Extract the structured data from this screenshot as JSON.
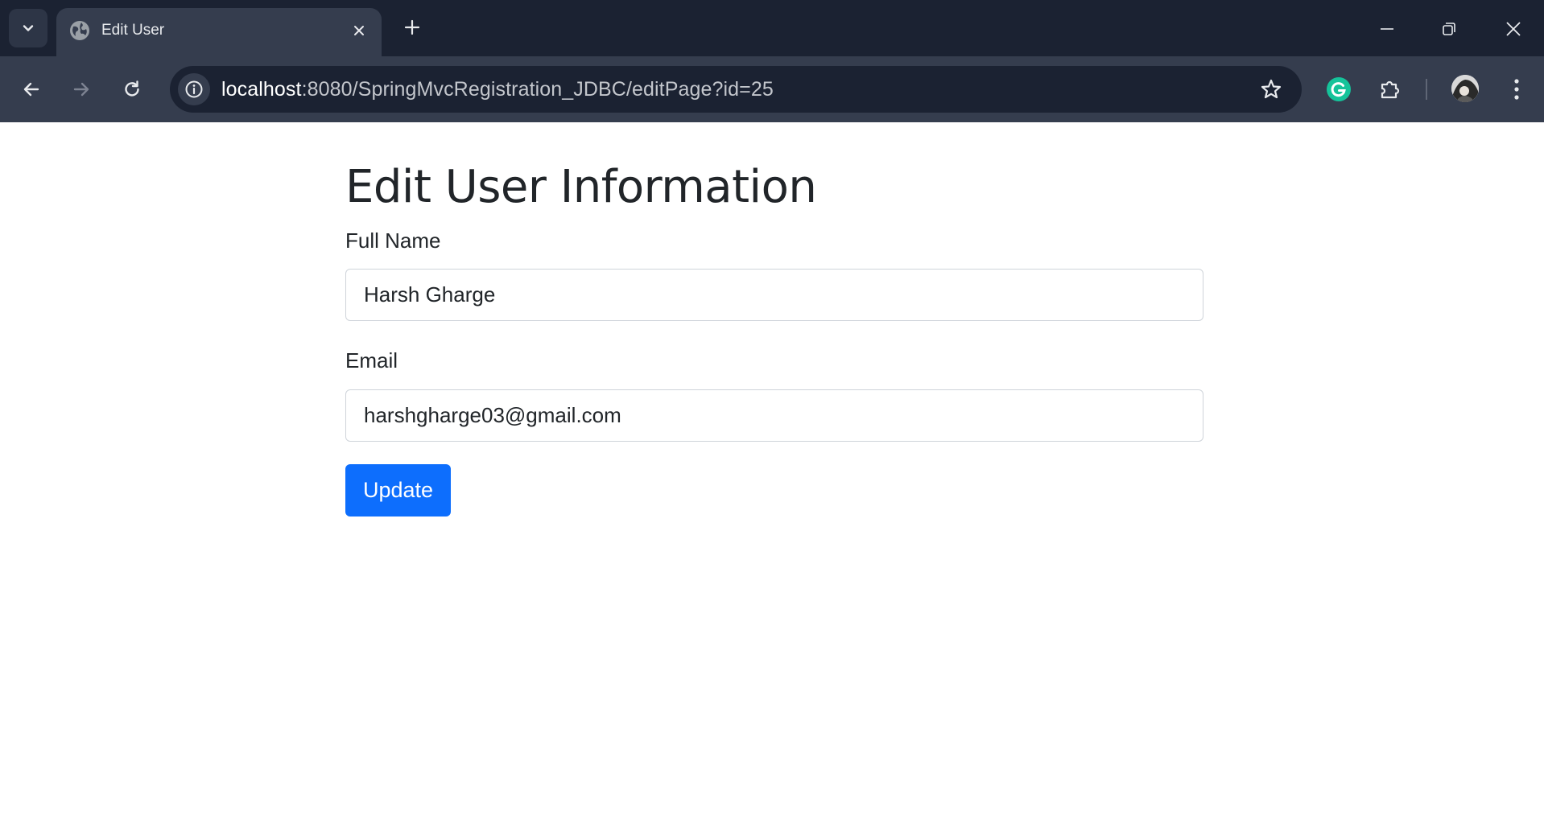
{
  "browser": {
    "tab": {
      "title": "Edit User"
    },
    "address": {
      "host": "localhost",
      "path": ":8080/SpringMvcRegistration_JDBC/editPage?id=25"
    },
    "icons": {
      "tab_search": "chevron-down-icon",
      "favicon": "globe-icon",
      "tab_close": "close-icon",
      "new_tab": "plus-icon",
      "back": "arrow-left-icon",
      "forward": "arrow-right-icon",
      "reload": "reload-icon",
      "site_info": "info-icon",
      "bookmark": "star-icon",
      "grammarly": "grammarly-icon",
      "extensions": "puzzle-icon",
      "menu": "kebab-menu-icon",
      "minimize": "minimize-icon",
      "restore": "restore-icon",
      "close_window": "close-icon"
    }
  },
  "page": {
    "title": "Edit User Information",
    "form": {
      "full_name_label": "Full Name",
      "full_name_value": "Harsh Gharge",
      "email_label": "Email",
      "email_value": "harshgharge03@gmail.com",
      "submit_label": "Update"
    }
  },
  "colors": {
    "chrome_dark": "#1b2232",
    "chrome_toolbar": "#353d4e",
    "primary_button": "#0d6efd",
    "text": "#212529",
    "input_border": "#cfd4da"
  }
}
